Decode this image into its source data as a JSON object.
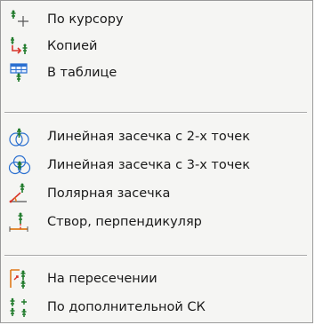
{
  "menu": {
    "items": [
      {
        "label": "По курсору",
        "icon": "cursor-point-icon"
      },
      {
        "label": "Копией",
        "icon": "copy-point-icon"
      },
      {
        "label": "В таблице",
        "icon": "table-point-icon"
      },
      {
        "label": "Линейная засечка с 2-х точек",
        "icon": "linear-intersection-2-icon"
      },
      {
        "label": "Линейная засечка с 3-х точек",
        "icon": "linear-intersection-3-icon"
      },
      {
        "label": "Полярная засечка",
        "icon": "polar-intersection-icon"
      },
      {
        "label": "Створ, перпендикуляр",
        "icon": "alignment-perpendicular-icon"
      },
      {
        "label": "На пересечении",
        "icon": "intersection-point-icon"
      },
      {
        "label": "По дополнительной СК",
        "icon": "additional-cs-icon"
      }
    ]
  },
  "colors": {
    "menu_background": "#f5f5f3",
    "point_icon_green": "#1f7a2a",
    "accent_red": "#d8342a",
    "accent_blue": "#2a6fd0",
    "accent_orange": "#e07a1a"
  }
}
